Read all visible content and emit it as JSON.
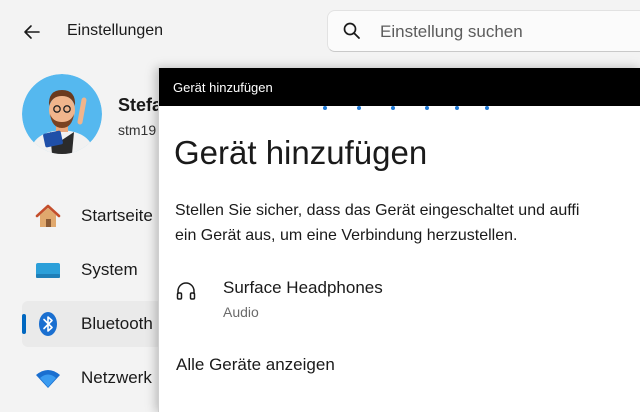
{
  "app": {
    "title": "Einstellungen"
  },
  "search": {
    "placeholder": "Einstellung suchen"
  },
  "user": {
    "name": "Stefa",
    "email": "stm19"
  },
  "nav": {
    "items": [
      {
        "label": "Startseite",
        "icon": "home-icon",
        "active": false
      },
      {
        "label": "System",
        "icon": "monitor-icon",
        "active": false
      },
      {
        "label": "Bluetooth",
        "icon": "bluetooth-icon",
        "active": true
      },
      {
        "label": "Netzwerk",
        "icon": "wifi-icon",
        "active": false
      }
    ]
  },
  "dialog": {
    "titlebar": "Gerät hinzufügen",
    "heading": "Gerät hinzufügen",
    "description_line1": "Stellen Sie sicher, dass das Gerät eingeschaltet und auffi",
    "description_line2": "ein Gerät aus, um eine Verbindung herzustellen.",
    "devices": [
      {
        "name": "Surface Headphones",
        "type": "Audio",
        "icon": "headphones-icon"
      }
    ],
    "show_all_label": "Alle Geräte anzeigen"
  },
  "colors": {
    "accent": "#0067c0",
    "progress_dots": "#1e78d4",
    "window_bg": "#f3f3f3",
    "dialog_bg": "#ffffff",
    "titlebar_bg": "#000000"
  }
}
